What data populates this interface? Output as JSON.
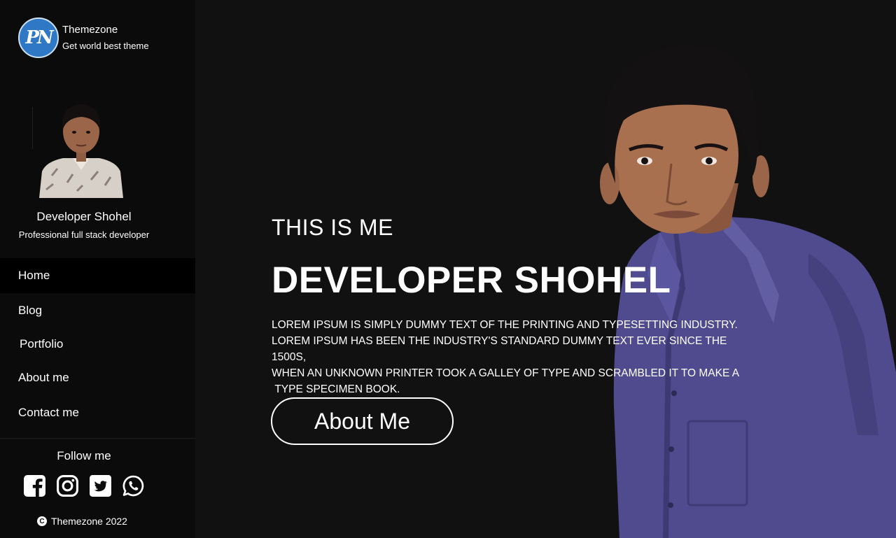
{
  "brand": {
    "logo_text": "PN",
    "name": "Themezone",
    "tagline": "Get world best theme"
  },
  "profile": {
    "name": "Developer Shohel",
    "role": "Professional full stack developer"
  },
  "nav": {
    "items": [
      {
        "label": "Home",
        "active": true
      },
      {
        "label": "Blog"
      },
      {
        "label": "Portfolio"
      },
      {
        "label": "About me"
      },
      {
        "label": "Contact me"
      }
    ]
  },
  "follow": {
    "title": "Follow me",
    "icons": [
      "facebook-icon",
      "instagram-icon",
      "twitter-icon",
      "whatsapp-icon"
    ]
  },
  "footer": {
    "copyright_symbol": "C",
    "copyright": "Themezone 2022"
  },
  "hero": {
    "kicker": "THIS IS ME",
    "title": "DEVELOPER SHOHEL",
    "description_lines": [
      "LOREM IPSUM IS SIMPLY DUMMY TEXT OF THE PRINTING AND TYPESETTING INDUSTRY.",
      "LOREM IPSUM HAS BEEN THE INDUSTRY'S STANDARD DUMMY TEXT EVER SINCE THE 1500S,",
      "WHEN AN UNKNOWN PRINTER TOOK A GALLEY OF TYPE AND SCRAMBLED IT TO MAKE A",
      "TYPE SPECIMEN BOOK."
    ],
    "button_label": "About Me"
  },
  "colors": {
    "background": "#121112",
    "sidebar": "#0b0b0b",
    "active_nav": "#000000",
    "text": "#ffffff",
    "logo_blue": "#2f78c5",
    "shirt": "#4f4b8e"
  }
}
